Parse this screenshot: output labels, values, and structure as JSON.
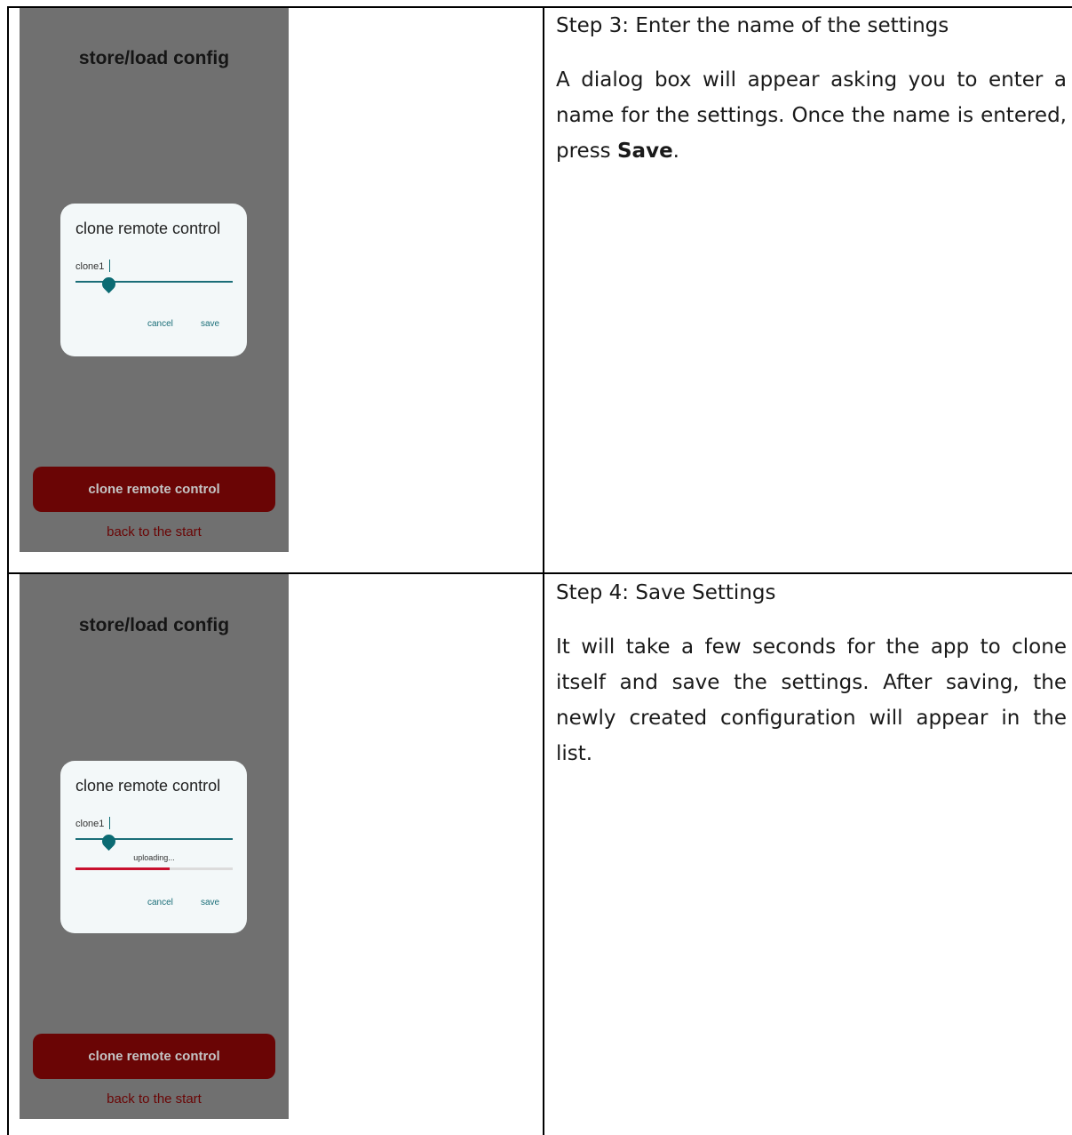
{
  "rows": [
    {
      "screenshot": {
        "title": "store/load config",
        "dialog": {
          "title": "clone remote control",
          "input_value": "clone1",
          "cancel_label": "cancel",
          "save_label": "save"
        },
        "primary_button": "clone remote control",
        "back_link": "back to the start"
      },
      "heading": "Step 3: Enter the name of the settings",
      "body_before": "A dialog box will appear asking you to enter a name for the settings. Once the name is entered, press ",
      "body_bold": "Save",
      "body_after": "."
    },
    {
      "screenshot": {
        "title": "store/load config",
        "dialog": {
          "title": "clone remote control",
          "input_value": "clone1",
          "progress_label": "uploading...",
          "progress": 0.6,
          "cancel_label": "cancel",
          "save_label": "save"
        },
        "primary_button": "clone remote control",
        "back_link": "back to the start"
      },
      "heading": "Step 4: Save Settings",
      "body": "It will take a few seconds for the app to clone itself and save the settings. After saving, the newly created configuration will appear in the list."
    }
  ],
  "colors": {
    "screen_bg": "#707070",
    "dialog_bg": "#f3f8f9",
    "accent_teal": "#1a6e78",
    "button_bg": "#6a0505",
    "progress_red": "#c8102e"
  }
}
